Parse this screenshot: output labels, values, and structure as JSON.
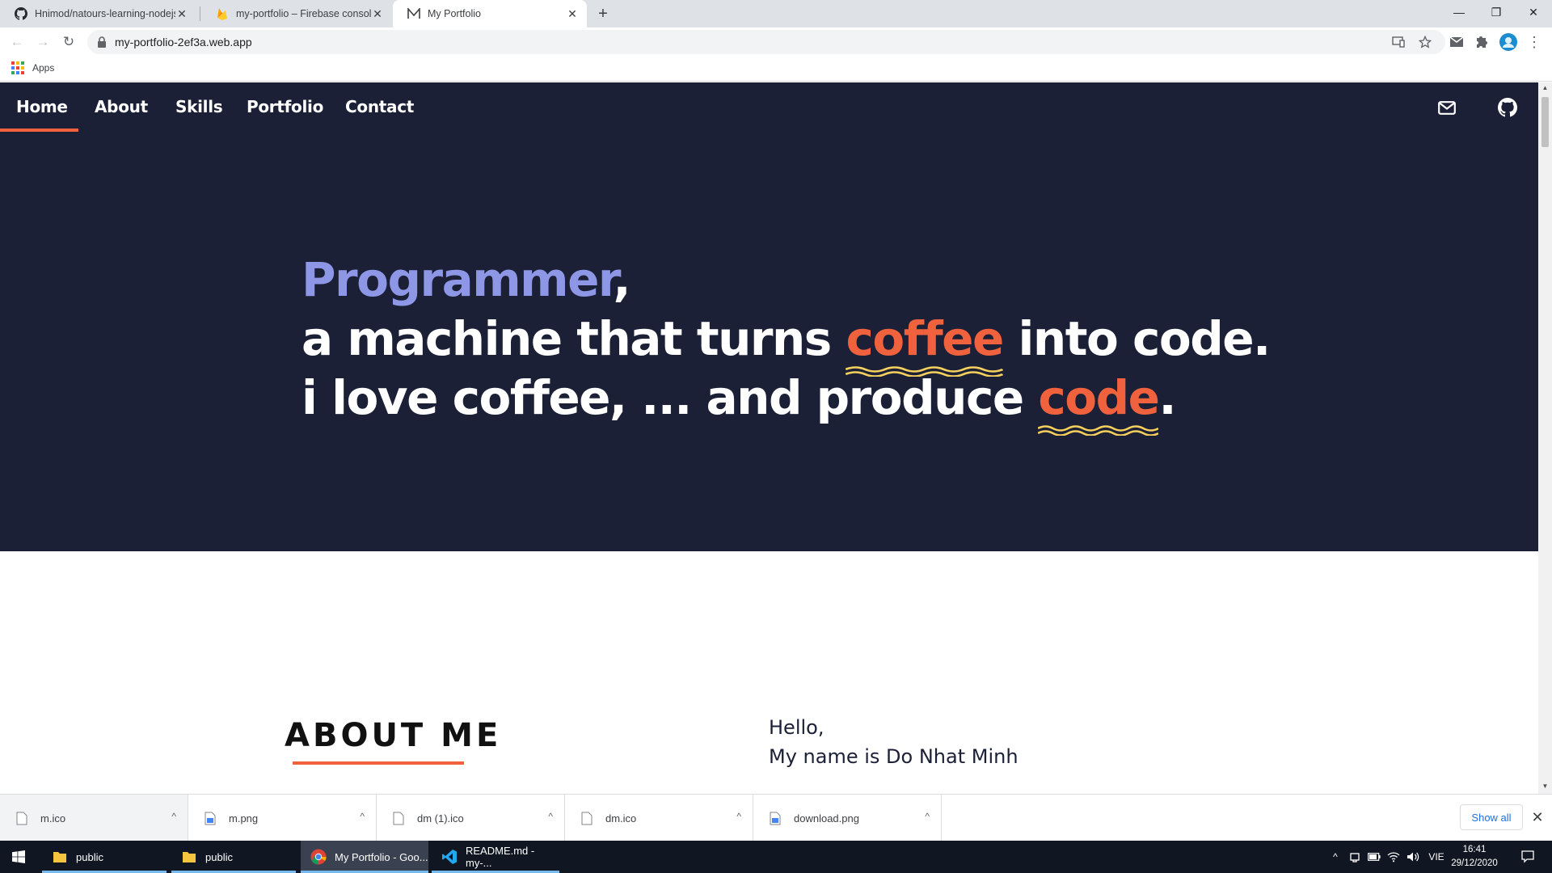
{
  "browser": {
    "tabs": [
      {
        "title": "Hnimod/natours-learning-nodejs",
        "icon": "github-icon",
        "active": false
      },
      {
        "title": "my-portfolio – Firebase console",
        "icon": "firebase-icon",
        "active": false
      },
      {
        "title": "My Portfolio",
        "icon": "portfolio-m-icon",
        "active": true
      }
    ],
    "url": "my-portfolio-2ef3a.web.app",
    "bookmarks": {
      "apps_label": "Apps"
    }
  },
  "site": {
    "nav": [
      "Home",
      "About",
      "Skills",
      "Portfolio",
      "Contact"
    ],
    "active_nav": "Home",
    "icons": [
      "mail-icon",
      "github-icon"
    ],
    "hero": {
      "line1_word": "Programmer",
      "line1_rest": ",",
      "line2_pre": "a machine that turns ",
      "line2_hl": "coffee",
      "line2_post": " into code.",
      "line3_pre": "i love coffee, ... and produce ",
      "line3_hl": "code",
      "line3_post": "."
    },
    "about": {
      "title": "ABOUT ME",
      "greeting": "Hello,",
      "name_line": "My name is Do Nhat Minh"
    },
    "colors": {
      "hero_bg": "#1b2036",
      "accent": "#f0623d",
      "highlight": "#8d97e6",
      "squiggle": "#f6d05c"
    }
  },
  "downloads": {
    "items": [
      "m.ico",
      "m.png",
      "dm (1).ico",
      "dm.ico",
      "download.png"
    ],
    "show_all": "Show all"
  },
  "taskbar": {
    "items": [
      "public",
      "public",
      "My Portfolio - Goo...",
      "README.md - my-..."
    ],
    "language": "VIE",
    "time": "16:41",
    "date": "29/12/2020"
  }
}
